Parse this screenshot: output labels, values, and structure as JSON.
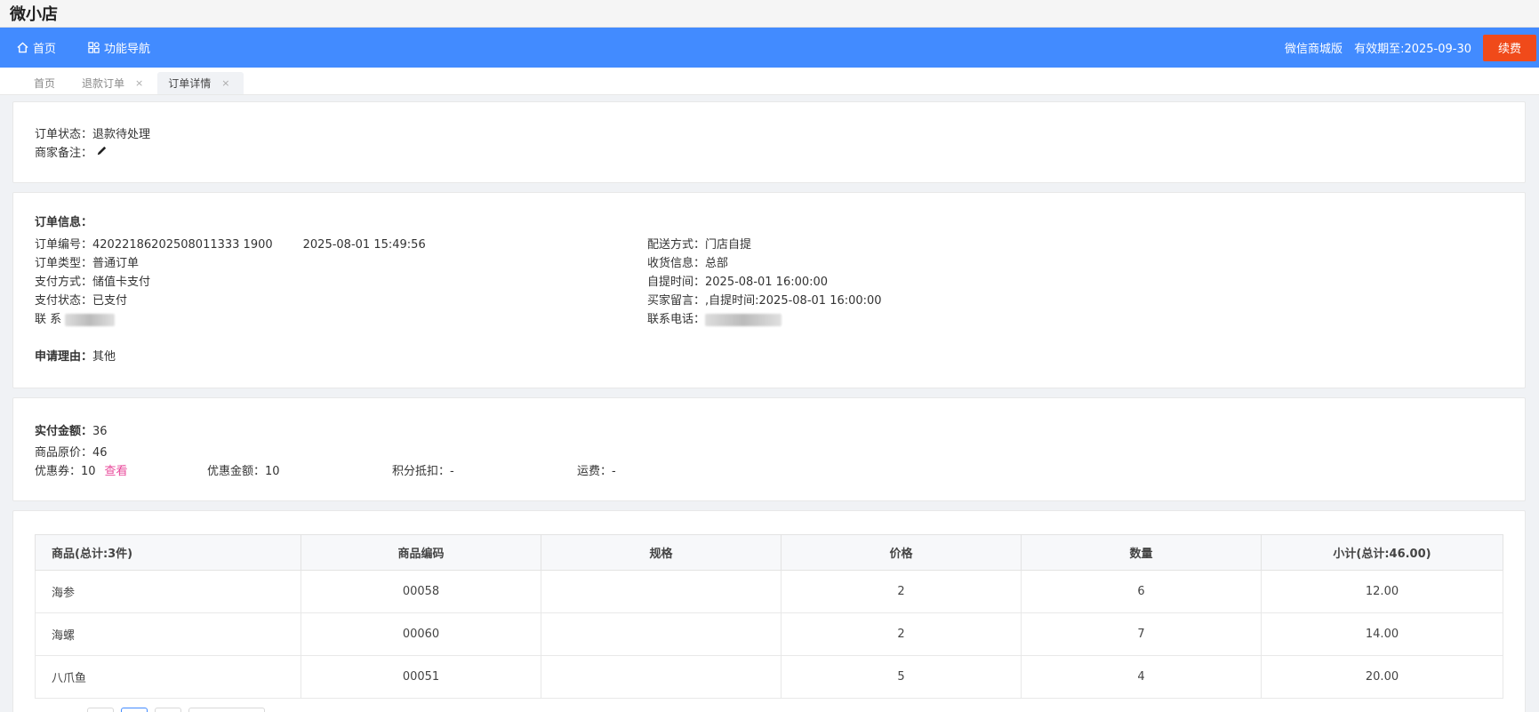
{
  "app": {
    "title": "微小店"
  },
  "nav": {
    "home": "首页",
    "func_nav": "功能导航",
    "edition": "微信商城版",
    "expiry": "有效期至:2025-09-30",
    "renew": "续费"
  },
  "tabs": [
    {
      "label": "首页"
    },
    {
      "label": "退款订单",
      "close": "×"
    },
    {
      "label": "订单详情",
      "close": "×"
    }
  ],
  "status": {
    "order_status": "订单状态：退款待处理",
    "merchant_note_label": "商家备注："
  },
  "info": {
    "title": "订单信息：",
    "order_no": "订单编号：42022186202508011333 1900",
    "order_time": "2025-08-01 15:49:56",
    "order_type": "订单类型：普通订单",
    "pay_method": "支付方式：储值卡支付",
    "pay_status": "支付状态：已支付",
    "contact_label": "联 系",
    "delivery": "配送方式：门店自提",
    "receiver": "收货信息：总部",
    "pickup_time": "自提时间：2025-08-01 16:00:00",
    "buyer_message": "买家留言：,自提时间:2025-08-01 16:00:00",
    "phone_label": "联系电话：",
    "reason_label": "申请理由：",
    "reason_value": "其他"
  },
  "amount": {
    "paid_label": "实付金额：",
    "paid_value": "36",
    "original": "商品原价：46",
    "coupon": "优惠券：10",
    "view": "查看",
    "discount": "优惠金额：10",
    "points": "积分抵扣：-",
    "freight": "运费：-"
  },
  "table": {
    "headers": [
      "商品(总计:3件)",
      "商品编码",
      "规格",
      "价格",
      "数量",
      "小计(总计:46.00)"
    ],
    "rows": [
      {
        "name": "海参",
        "code": "00058",
        "spec": "",
        "price": "2",
        "qty": "6",
        "subtotal": "12.00"
      },
      {
        "name": "海螺",
        "code": "00060",
        "spec": "",
        "price": "2",
        "qty": "7",
        "subtotal": "14.00"
      },
      {
        "name": "八爪鱼",
        "code": "00051",
        "spec": "",
        "price": "5",
        "qty": "4",
        "subtotal": "20.00"
      }
    ]
  }
}
